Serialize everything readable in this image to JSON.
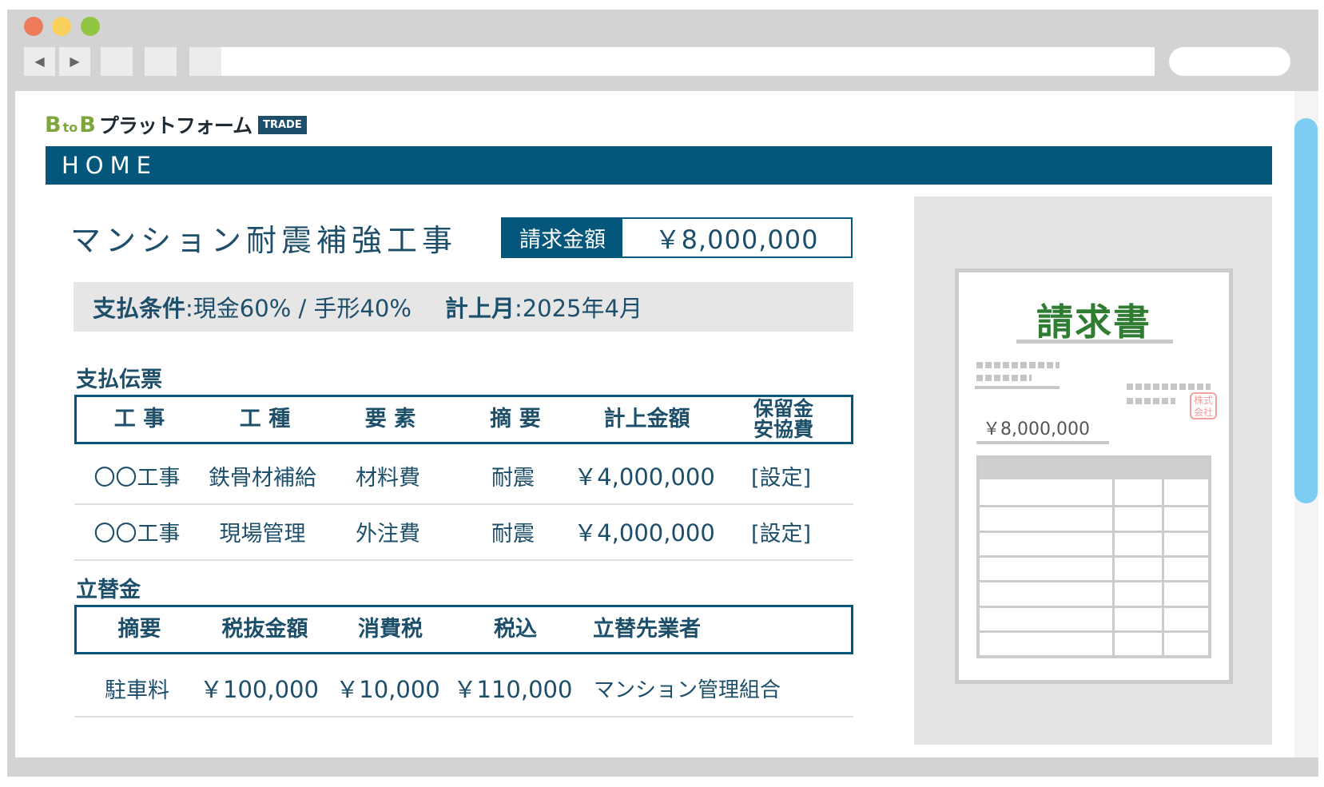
{
  "browser": {
    "back_glyph": "◀",
    "forward_glyph": "▶",
    "traffic_lights": [
      "#ee7a5c",
      "#f9d05b",
      "#8fc540"
    ]
  },
  "logo": {
    "b1": "B",
    "to": "to",
    "b2": "B",
    "name": "プラットフォーム",
    "badge": "TRADE"
  },
  "nav": {
    "home": "HOME"
  },
  "project": {
    "title": "マンション耐震補強工事",
    "amount_label": "請求金額",
    "amount_value": "￥8,000,000"
  },
  "terms": {
    "payment_label": "支払条件",
    "payment_value": ":現金60% / 手形40%",
    "month_label": "計上月",
    "month_value": ":2025年4月"
  },
  "payment_slip": {
    "title": "支払伝票",
    "headers": [
      "工 事",
      "工 種",
      "要 素",
      "摘 要",
      "計上金額",
      "保留金",
      "安協費"
    ],
    "rows": [
      [
        "〇〇工事",
        "鉄骨材補給",
        "材料費",
        "耐震",
        "￥4,000,000",
        "[設定]"
      ],
      [
        "〇〇工事",
        "現場管理",
        "外注費",
        "耐震",
        "￥4,000,000",
        "[設定]"
      ]
    ]
  },
  "advance": {
    "title": "立替金",
    "headers": [
      "摘要",
      "税抜金額",
      "消費税",
      "税込",
      "立替先業者"
    ],
    "rows": [
      [
        "駐車料",
        "￥100,000",
        "￥10,000",
        "￥110,000",
        "マンション管理組合"
      ]
    ]
  },
  "invoice_preview": {
    "title": "請求書",
    "seal": "株式会社",
    "amount": "￥8,000,000"
  },
  "colors": {
    "primary": "#04577a",
    "text": "#1d4f6b",
    "accent_green": "#7fa63a",
    "doc_green": "#2e7d32",
    "scrollbar": "#7ecef4"
  }
}
